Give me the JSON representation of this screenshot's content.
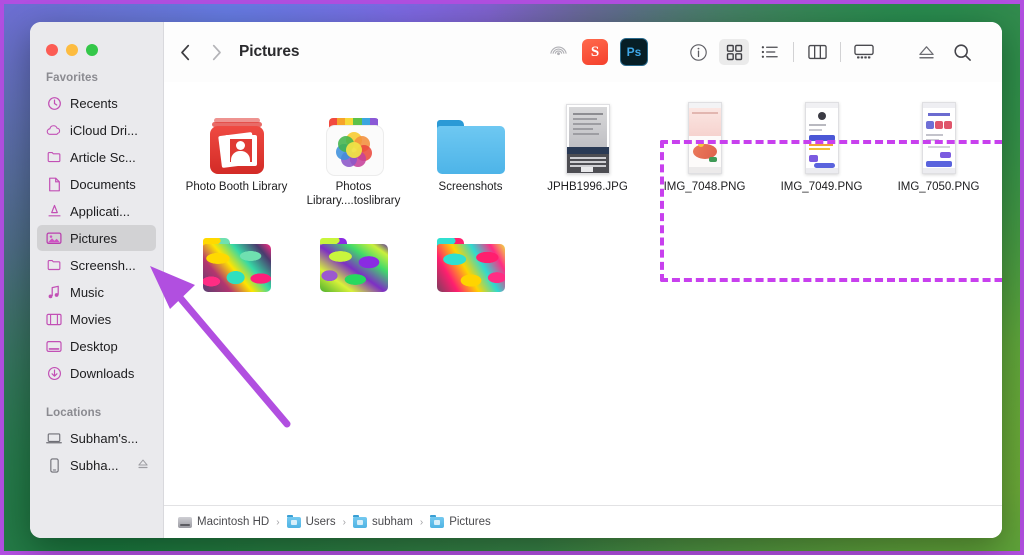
{
  "window": {
    "title": "Pictures",
    "traffic_lights": [
      {
        "name": "close",
        "color": "#fc5c54"
      },
      {
        "name": "minimize",
        "color": "#fdbc40"
      },
      {
        "name": "zoom",
        "color": "#34c749"
      }
    ]
  },
  "desktop": {
    "background_colors": [
      "#7b63d8",
      "#8a55c9",
      "#2f8a45",
      "#7fb331",
      "#6f7bf7"
    ],
    "border_color": "#b14fe0"
  },
  "sidebar": {
    "sections": [
      {
        "header": "Favorites",
        "items": [
          {
            "label": "Recents",
            "icon": "clock-icon",
            "selected": false
          },
          {
            "label": "iCloud Dri...",
            "icon": "cloud-icon",
            "selected": false
          },
          {
            "label": "Article Sc...",
            "icon": "folder-icon",
            "selected": false
          },
          {
            "label": "Documents",
            "icon": "document-icon",
            "selected": false
          },
          {
            "label": "Applicati...",
            "icon": "applications-icon",
            "selected": false
          },
          {
            "label": "Pictures",
            "icon": "pictures-icon",
            "selected": true
          },
          {
            "label": "Screensh...",
            "icon": "folder-icon",
            "selected": false
          },
          {
            "label": "Music",
            "icon": "music-note-icon",
            "selected": false
          },
          {
            "label": "Movies",
            "icon": "film-icon",
            "selected": false
          },
          {
            "label": "Desktop",
            "icon": "desktop-icon",
            "selected": false
          },
          {
            "label": "Downloads",
            "icon": "download-icon",
            "selected": false
          }
        ]
      },
      {
        "header": "Locations",
        "items": [
          {
            "label": "Subham's...",
            "icon": "laptop-icon",
            "selected": false,
            "eject": false
          },
          {
            "label": "Subha...",
            "icon": "iphone-icon",
            "selected": false,
            "eject": true
          }
        ]
      }
    ]
  },
  "toolbar": {
    "back_label": "Back",
    "forward_label": "Forward",
    "title": "Pictures",
    "buttons": [
      {
        "name": "airdrop-icon",
        "label": "AirDrop"
      },
      {
        "name": "sidekick-app-icon",
        "label": "S"
      },
      {
        "name": "photoshop-app-icon",
        "label": "Ps"
      },
      {
        "name": "info-icon",
        "label": "Get Info"
      },
      {
        "name": "icon-view-icon",
        "label": "Icon View",
        "active": true
      },
      {
        "name": "list-view-icon",
        "label": "List View",
        "active": false
      },
      {
        "name": "column-view-icon",
        "label": "Column View",
        "active": false
      },
      {
        "name": "gallery-view-icon",
        "label": "Gallery View",
        "active": false
      },
      {
        "name": "eject-icon",
        "label": "Eject"
      },
      {
        "name": "search-icon",
        "label": "Search"
      }
    ]
  },
  "files": {
    "rows": [
      [
        {
          "name": "Photo Booth Library",
          "label": "Photo Booth Library",
          "kind": "photo-booth-library",
          "selected": false
        },
        {
          "name": "Photos Library.photoslibrary",
          "label": "Photos Library....toslibrary",
          "kind": "photos-library",
          "selected": false
        },
        {
          "name": "Screenshots",
          "label": "Screenshots",
          "kind": "folder-blue",
          "selected": false
        },
        {
          "name": "JPHB1996.JPG",
          "label": "JPHB1996.JPG",
          "kind": "image-laptop",
          "selected": true
        },
        {
          "name": "IMG_7048.PNG",
          "label": "IMG_7048.PNG",
          "kind": "image-phone-pink",
          "selected": true
        },
        {
          "name": "IMG_7049.PNG",
          "label": "IMG_7049.PNG",
          "kind": "image-phone-blue",
          "selected": true
        },
        {
          "name": "IMG_7050.PNG",
          "label": "IMG_7050.PNG",
          "kind": "image-phone-purple",
          "selected": true
        }
      ],
      [
        {
          "name": "folder-art-1",
          "label": "",
          "kind": "folder-art-1",
          "selected": false
        },
        {
          "name": "folder-art-2",
          "label": "",
          "kind": "folder-art-2",
          "selected": false
        },
        {
          "name": "folder-art-3",
          "label": "",
          "kind": "folder-art-3",
          "selected": false
        }
      ]
    ]
  },
  "annotations": {
    "selection_box_color": "#c840ee",
    "arrow_color": "#b14fe0",
    "arrow_points_to": "Pictures"
  },
  "pathbar": {
    "crumbs": [
      {
        "label": "Macintosh HD",
        "icon": "hard-drive-icon"
      },
      {
        "label": "Users",
        "icon": "folder-icon"
      },
      {
        "label": "subham",
        "icon": "folder-icon"
      },
      {
        "label": "Pictures",
        "icon": "folder-icon"
      }
    ],
    "separator": "›"
  }
}
